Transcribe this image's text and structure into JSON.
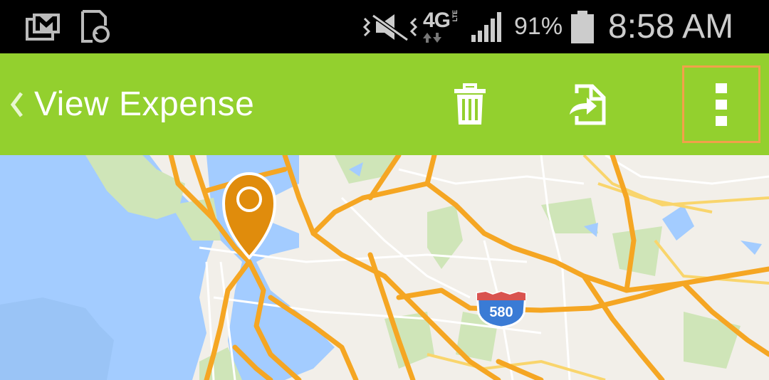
{
  "status_bar": {
    "network": "4G",
    "network_sub": "LTE",
    "battery": "91%",
    "time": "8:58 AM",
    "icons": [
      "gmail-icon",
      "sync-icon",
      "mute-icon",
      "signal-icon",
      "battery-icon"
    ]
  },
  "app_bar": {
    "title": "View Expense",
    "back_icon": "chevron-left-icon",
    "actions": [
      "trash-icon",
      "export-icon",
      "more-vert-icon"
    ],
    "color": "#93d02e"
  },
  "map": {
    "highway_shield": "580",
    "pin_color": "#e08c0c",
    "water_color": "#a3ccff",
    "road_color": "#f5a623"
  }
}
